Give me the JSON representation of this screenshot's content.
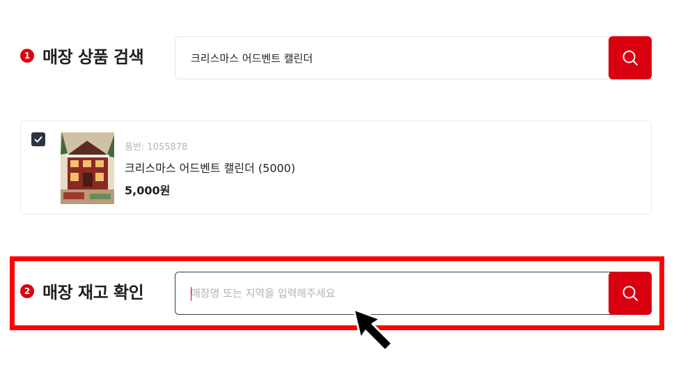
{
  "step1": {
    "number": "1",
    "label": "매장 상품 검색",
    "search_value": "크리스마스 어드벤트 캘린더"
  },
  "product": {
    "checked": true,
    "code": "품번: 1055878",
    "name": "크리스마스 어드벤트 캘린더 (5000)",
    "price": "5,000원"
  },
  "step2": {
    "number": "2",
    "label": "매장 재고 확인",
    "search_value": "",
    "placeholder": "매장명 또는 지역을 입력해주세요"
  },
  "icons": {
    "search": "search-icon",
    "check": "check-icon",
    "cursor": "mouse-pointer-icon"
  },
  "colors": {
    "accent": "#d9000f",
    "highlight": "#ff0000",
    "checkbox": "#2d3441"
  }
}
